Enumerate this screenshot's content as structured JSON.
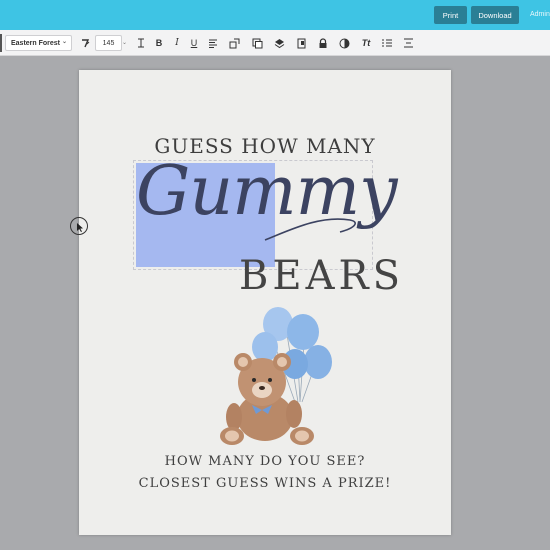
{
  "header": {
    "print_label": "Print",
    "download_label": "Download",
    "admin_label": "Admin"
  },
  "toolbar": {
    "font_family": "Eastern Forest",
    "font_size": "145",
    "icons": [
      "text-effect-icon",
      "letter-spacing-icon",
      "bold-icon",
      "italic-icon",
      "underline-icon",
      "align-icon",
      "image-replace-icon",
      "duplicate-icon",
      "layers-icon",
      "copy-icon",
      "lock-icon",
      "color-icon",
      "text-transform-icon",
      "list-icon",
      "line-height-icon"
    ]
  },
  "canvas": {
    "title_top": "GUESS HOW MANY",
    "title_script": "Gummy",
    "title_bottom": "BEARS",
    "line1": "HOW MANY DO YOU SEE?",
    "line2": "CLOSEST GUESS WINS A PRIZE!"
  },
  "colors": {
    "header_bg": "#3ec4e4",
    "button_bg": "#2a7f95",
    "selection": "#a5b8f0",
    "balloon": "#8db7e8",
    "bear": "#b98968"
  }
}
